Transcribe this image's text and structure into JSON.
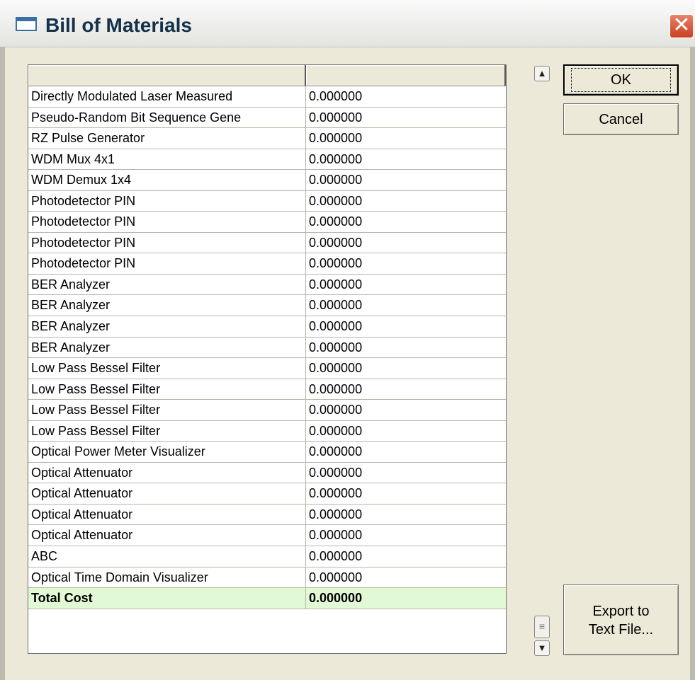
{
  "window": {
    "title": "Bill of Materials",
    "close_glyph": "✕"
  },
  "table": {
    "columns": [
      "",
      ""
    ],
    "rows": [
      {
        "name": "Directly Modulated Laser Measured",
        "cost": "0.000000"
      },
      {
        "name": "Pseudo-Random Bit Sequence Gene",
        "cost": "0.000000"
      },
      {
        "name": "RZ Pulse Generator",
        "cost": "0.000000"
      },
      {
        "name": "WDM Mux 4x1",
        "cost": "0.000000"
      },
      {
        "name": "WDM Demux 1x4",
        "cost": "0.000000"
      },
      {
        "name": "Photodetector PIN",
        "cost": "0.000000"
      },
      {
        "name": "Photodetector PIN",
        "cost": "0.000000"
      },
      {
        "name": "Photodetector PIN",
        "cost": "0.000000"
      },
      {
        "name": "Photodetector PIN",
        "cost": "0.000000"
      },
      {
        "name": "BER Analyzer",
        "cost": "0.000000"
      },
      {
        "name": "BER Analyzer",
        "cost": "0.000000"
      },
      {
        "name": "BER Analyzer",
        "cost": "0.000000"
      },
      {
        "name": "BER Analyzer",
        "cost": "0.000000"
      },
      {
        "name": "Low Pass Bessel Filter",
        "cost": "0.000000"
      },
      {
        "name": "Low Pass Bessel Filter",
        "cost": "0.000000"
      },
      {
        "name": "Low Pass Bessel Filter",
        "cost": "0.000000"
      },
      {
        "name": "Low Pass Bessel Filter",
        "cost": "0.000000"
      },
      {
        "name": "Optical Power Meter Visualizer",
        "cost": "0.000000"
      },
      {
        "name": "Optical Attenuator",
        "cost": "0.000000"
      },
      {
        "name": "Optical Attenuator",
        "cost": "0.000000"
      },
      {
        "name": "Optical Attenuator",
        "cost": "0.000000"
      },
      {
        "name": "Optical Attenuator",
        "cost": "0.000000"
      },
      {
        "name": "ABC",
        "cost": "0.000000"
      },
      {
        "name": "Optical Time Domain Visualizer",
        "cost": "0.000000"
      }
    ],
    "total": {
      "name": "Total Cost",
      "cost": "0.000000"
    }
  },
  "buttons": {
    "ok": "OK",
    "cancel": "Cancel",
    "export_line1": "Export to",
    "export_line2": "Text File..."
  },
  "scrollbar": {
    "up_icon": "chevron-up-icon",
    "down_icon": "chevron-down-icon",
    "thumb_icon": "grip-icon"
  },
  "colors": {
    "dialog_bg": "#ece9d8",
    "total_row_bg": "#e2f9d6",
    "close_button": "#c9401f"
  }
}
